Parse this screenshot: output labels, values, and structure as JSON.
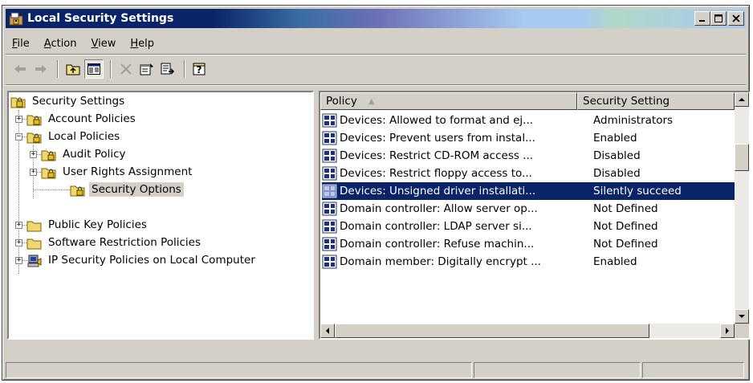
{
  "window": {
    "title": "Local Security Settings",
    "caption_buttons": [
      "_",
      "□",
      "X"
    ]
  },
  "menu": [
    {
      "label": "File",
      "mnemonic": "F",
      "rest": "ile"
    },
    {
      "label": "Action",
      "mnemonic": "A",
      "rest": "ction"
    },
    {
      "label": "View",
      "mnemonic": "V",
      "rest": "iew"
    },
    {
      "label": "Help",
      "mnemonic": "H",
      "rest": "elp"
    }
  ],
  "toolbar": {
    "icons": [
      "back-arrow-icon",
      "forward-arrow-icon",
      "up-folder-icon",
      "show-hide-tree-icon",
      "delete-icon",
      "properties-icon",
      "export-list-icon",
      "help-icon"
    ]
  },
  "tree": {
    "root": "Security Settings",
    "items": [
      {
        "label": "Account Policies",
        "level": 1,
        "expander": "+"
      },
      {
        "label": "Local Policies",
        "level": 1,
        "expander": "−"
      },
      {
        "label": "Audit Policy",
        "level": 2,
        "expander": "+"
      },
      {
        "label": "User Rights Assignment",
        "level": 2,
        "expander": "+"
      },
      {
        "label": "Security Options",
        "level": 2,
        "expander": "",
        "selected": true
      },
      {
        "label": "Public Key Policies",
        "level": 1,
        "expander": "+"
      },
      {
        "label": "Software Restriction Policies",
        "level": 1,
        "expander": "+"
      },
      {
        "label": "IP Security Policies on Local Computer",
        "level": 1,
        "expander": "+"
      }
    ]
  },
  "list": {
    "columns": [
      "Policy",
      "Security Setting"
    ],
    "sort_indicator": "▲",
    "rows": [
      {
        "policy": "Devices: Allowed to format and ej...",
        "setting": "Administrators"
      },
      {
        "policy": "Devices: Prevent users from instal...",
        "setting": "Enabled"
      },
      {
        "policy": "Devices: Restrict CD-ROM access ...",
        "setting": "Disabled"
      },
      {
        "policy": "Devices: Restrict floppy access to...",
        "setting": "Disabled"
      },
      {
        "policy": "Devices: Unsigned driver installati...",
        "setting": "Silently succeed",
        "selected": true
      },
      {
        "policy": "Domain controller: Allow server op...",
        "setting": "Not Defined"
      },
      {
        "policy": "Domain controller: LDAP server si...",
        "setting": "Not Defined"
      },
      {
        "policy": "Domain controller: Refuse machin...",
        "setting": "Not Defined"
      },
      {
        "policy": "Domain member: Digitally encrypt ...",
        "setting": "Enabled"
      }
    ]
  },
  "colors": {
    "selection": "#0a246a",
    "face": "#d4d0c8"
  }
}
